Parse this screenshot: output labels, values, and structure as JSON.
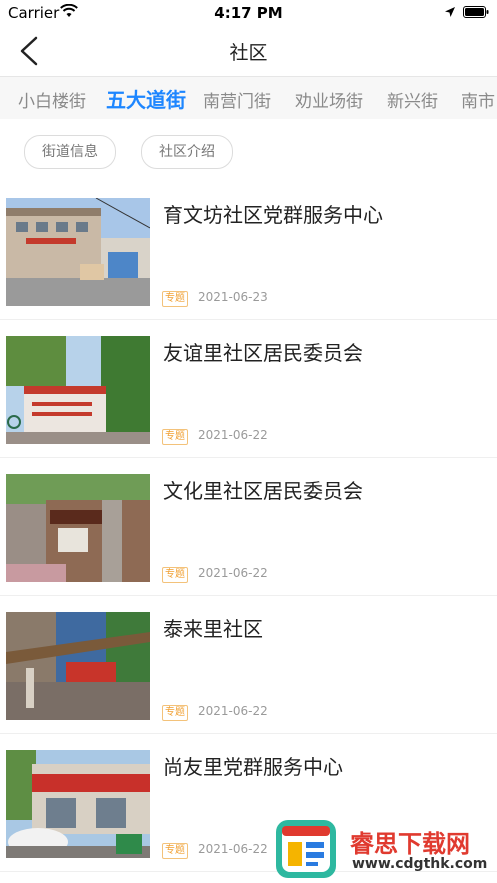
{
  "status_bar": {
    "carrier": "Carrier",
    "time": "4:17 PM"
  },
  "nav": {
    "title": "社区"
  },
  "tabs": [
    {
      "label": "小白楼街",
      "active": false
    },
    {
      "label": "五大道街",
      "active": true
    },
    {
      "label": "南营门街",
      "active": false
    },
    {
      "label": "劝业场街",
      "active": false
    },
    {
      "label": "新兴街",
      "active": false
    },
    {
      "label": "南市",
      "active": false
    }
  ],
  "filters": [
    "街道信息",
    "社区介绍"
  ],
  "articles": [
    {
      "title": "育文坊社区党群服务中心",
      "tag": "专题",
      "date": "2021-06-23"
    },
    {
      "title": "友谊里社区居民委员会",
      "tag": "专题",
      "date": "2021-06-22"
    },
    {
      "title": "文化里社区居民委员会",
      "tag": "专题",
      "date": "2021-06-22"
    },
    {
      "title": "泰来里社区",
      "tag": "专题",
      "date": "2021-06-22"
    },
    {
      "title": "尚友里党群服务中心",
      "tag": "专题",
      "date": "2021-06-22"
    }
  ],
  "watermark": {
    "title": "睿思下载网",
    "url": "www.cdgthk.com"
  },
  "colors": {
    "accent": "#1d86ff",
    "tag": "#f0a033",
    "watermark": "#e03a2f"
  }
}
